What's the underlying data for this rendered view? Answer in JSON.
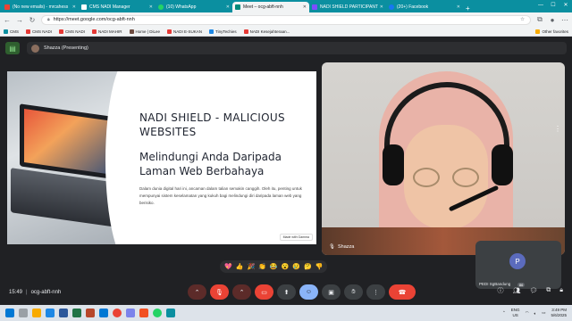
{
  "browser": {
    "tabs": [
      {
        "title": "(No new emails) - mrcahess",
        "color": "#ea4335"
      },
      {
        "title": "CMS NADI Manager",
        "color": "#ffffff"
      },
      {
        "title": "(10) WhatsApp",
        "color": "#25d366"
      },
      {
        "title": "Meet – ocg-abft-nnh",
        "color": "#00897b",
        "active": true
      },
      {
        "title": "NADI SHIELD PARTICIPANT",
        "color": "#7c4dff"
      },
      {
        "title": "(20+) Facebook",
        "color": "#1877f2"
      }
    ],
    "url": "https://meet.google.com/ocg-abft-nnh",
    "bookmarks": [
      "CMS",
      "CMS NADI",
      "CMS NADI",
      "NADI MAHIR",
      "Home | DiLee",
      "NADI E-SUKAN",
      "TinyTechies",
      "NADI Kesejahteraan..."
    ],
    "other_bookmarks": "Other favorites"
  },
  "meet": {
    "presenting_label": "Shazza (Presenting)",
    "slide": {
      "title": "NADI SHIELD - MALICIOUS WEBSITES",
      "subtitle": "Melindungi Anda Daripada Laman Web Berbahaya",
      "body": "Dalam dunia digital hari ini, ancaman dalam talian semakin canggih. Oleh itu, penting untuk mempunyai sistem keselamatan yang kukuh bagi melindungi diri daripada laman web yang berisiko.",
      "watermark": "Made with Gamma"
    },
    "camera_name": "Shazza",
    "participant_tile": {
      "initial": "P",
      "name": "PEDI SgBandung"
    },
    "reactions": [
      "💖",
      "👍",
      "🎉",
      "👏",
      "😂",
      "😮",
      "😢",
      "🤔",
      "👎"
    ],
    "time": "15:49",
    "meeting_code": "ocg-abft-nnh",
    "participant_count": "86"
  },
  "taskbar": {
    "lang": "ENG",
    "region": "US",
    "time": "3:49 PM",
    "date": "5/6/2025"
  }
}
